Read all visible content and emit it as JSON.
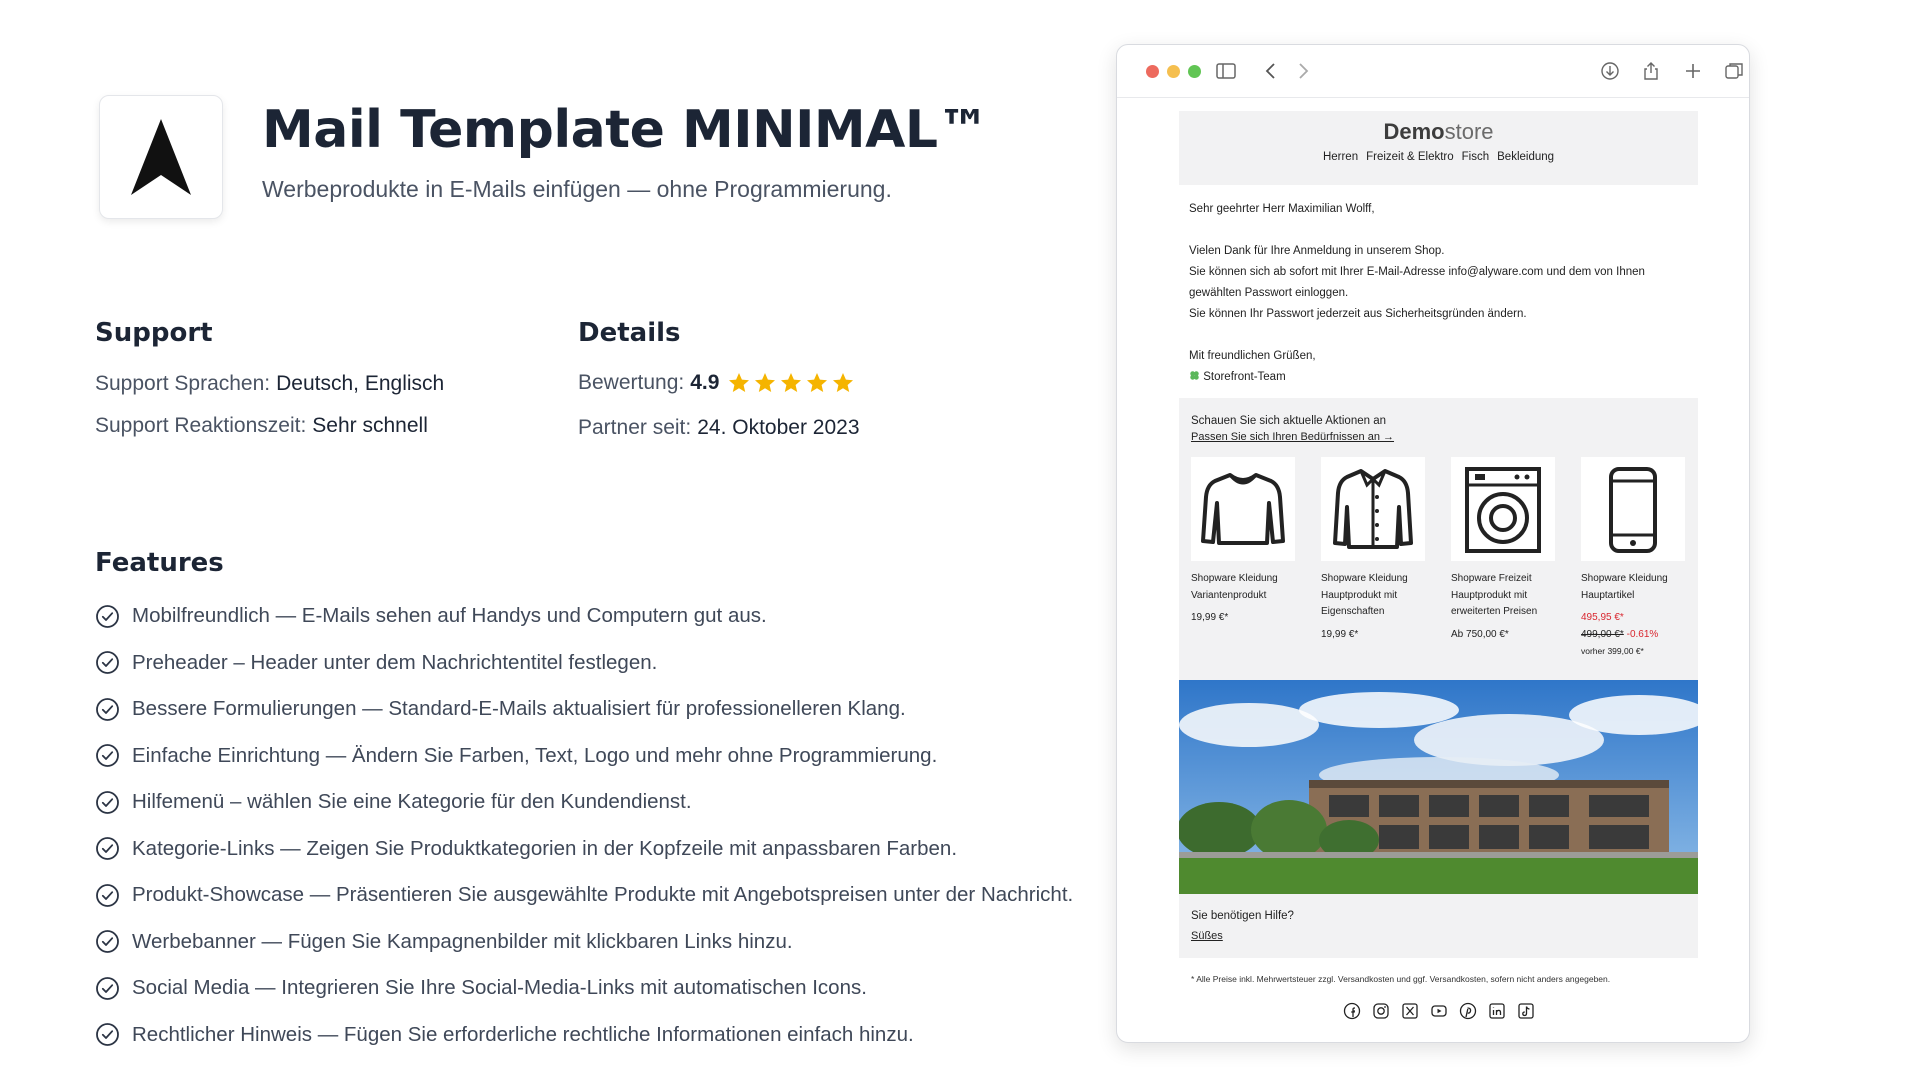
{
  "app": {
    "title": "Mail Template MINIMAL™",
    "subtitle": "Werbeprodukte in E-Mails einfügen — ohne Programmierung."
  },
  "support": {
    "heading": "Support",
    "languages_label": "Support Sprachen:",
    "languages_value": "Deutsch, Englisch",
    "response_label": "Support Reaktionszeit:",
    "response_value": "Sehr schnell"
  },
  "details": {
    "heading": "Details",
    "rating_label": "Bewertung:",
    "rating_value": "4.9",
    "stars": 5,
    "partner_label": "Partner seit:",
    "partner_value": "24. Oktober 2023",
    "star_color": "#f5b400"
  },
  "features": {
    "heading": "Features",
    "items": [
      "Mobilfreundlich — E-Mails sehen auf Handys und Computern gut aus.",
      "Preheader – Header unter dem Nachrichtentitel festlegen.",
      "Bessere Formulierungen — Standard-E-Mails aktualisiert für professionelleren Klang.",
      "Einfache Einrichtung — Ändern Sie Farben, Text, Logo und mehr ohne Programmierung.",
      "Hilfemenü – wählen Sie eine Kategorie für den Kundendienst.",
      "Kategorie-Links — Zeigen Sie Produktkategorien in der Kopfzeile mit anpassbaren Farben.",
      "Produkt-Showcase — Präsentieren Sie ausgewählte Produkte mit Angebotspreisen unter der Nachricht.",
      "Werbebanner — Fügen Sie Kampagnenbilder mit klickbaren Links hinzu.",
      "Social Media — Integrieren Sie Ihre Social-Media-Links mit automatischen Icons.",
      "Rechtlicher Hinweis — Fügen Sie erforderliche rechtliche Informationen einfach hinzu."
    ]
  },
  "browser": {
    "traffic_colors": [
      "#ed6a5e",
      "#f5bf4f",
      "#61c554"
    ],
    "icons": [
      "sidebar-icon",
      "back-icon",
      "forward-icon",
      "download-icon",
      "share-icon",
      "new-tab-icon",
      "tabs-overview-icon"
    ]
  },
  "email": {
    "brand_bold": "Demo",
    "brand_light": "store",
    "nav": [
      "Herren",
      "Freizeit & Elektro",
      "Fisch",
      "Bekleidung"
    ],
    "greeting": "Sehr geehrter Herr Maximilian Wolff,",
    "body_lines": [
      "Vielen Dank für Ihre Anmeldung in unserem Shop.",
      "Sie können sich ab sofort mit Ihrer E-Mail-Adresse info@alyware.com und dem von Ihnen gewählten Passwort einloggen.",
      "Sie können Ihr Passwort jederzeit aus Sicherheitsgründen ändern."
    ],
    "closing": "Mit freundlichen Grüßen,",
    "signature": "Storefront-Team",
    "promo_heading": "Schauen Sie sich aktuelle Aktionen an",
    "promo_link": "Passen Sie sich Ihren Bedürfnissen an →",
    "products": [
      {
        "name": "Shopware Kleidung Variantenprodukt",
        "icon": "sweater-icon",
        "price": "19,99 €*"
      },
      {
        "name": "Shopware Kleidung Hauptprodukt mit Eigenschaften",
        "icon": "jacket-icon",
        "price": "19,99 €*"
      },
      {
        "name": "Shopware Freizeit Hauptprodukt mit erweiterten Preisen",
        "icon": "washing-machine-icon",
        "price": "Ab 750,00 €*"
      },
      {
        "name": "Shopware Kleidung Hauptartikel",
        "icon": "smartphone-icon",
        "price": "495,95 €*",
        "old_price": "499,00 €*",
        "discount": "-0.61%",
        "before": "vorher 399,00 €*"
      }
    ],
    "help_heading": "Sie benötigen Hilfe?",
    "help_link": "Süßes",
    "footnote": "* Alle Preise inkl. Mehrwertsteuer zzgl. Versandkosten und ggf. Versandkosten, sofern nicht anders angegeben.",
    "socials": [
      "facebook-icon",
      "instagram-icon",
      "x-icon",
      "youtube-icon",
      "pinterest-icon",
      "linkedin-icon",
      "tiktok-icon"
    ],
    "sale_color": "#d9262e"
  }
}
